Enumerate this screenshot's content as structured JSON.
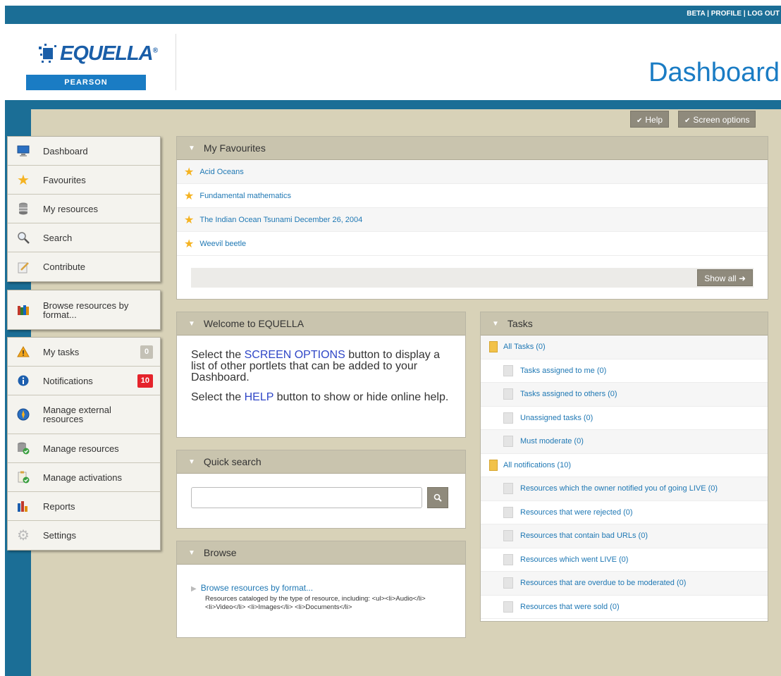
{
  "topbar": {
    "links": "BETA | PROFILE | LOG OUT"
  },
  "brand": {
    "name": "EQUELLA",
    "reg": "®",
    "publisher": "PEARSON"
  },
  "page": {
    "title": "Dashboard"
  },
  "toolbar": {
    "help": "Help",
    "screen_options": "Screen options"
  },
  "sidebar": {
    "group1": [
      {
        "label": "Dashboard",
        "icon": "monitor-icon"
      },
      {
        "label": "Favourites",
        "icon": "star-icon"
      },
      {
        "label": "My resources",
        "icon": "database-icon"
      },
      {
        "label": "Search",
        "icon": "magnifier-icon"
      },
      {
        "label": "Contribute",
        "icon": "edit-icon"
      }
    ],
    "group2": [
      {
        "label": "Browse resources by format...",
        "icon": "books-icon"
      }
    ],
    "group3": [
      {
        "label": "My tasks",
        "icon": "warning-icon",
        "badge": "0"
      },
      {
        "label": "Notifications",
        "icon": "info-icon",
        "badge": "10"
      },
      {
        "label": "Manage external resources",
        "icon": "compass-icon"
      },
      {
        "label": "Manage resources",
        "icon": "database-check-icon"
      },
      {
        "label": "Manage activations",
        "icon": "clipboard-check-icon"
      },
      {
        "label": "Reports",
        "icon": "bar-chart-icon"
      },
      {
        "label": "Settings",
        "icon": "gear-icon"
      }
    ]
  },
  "favourites": {
    "title": "My Favourites",
    "items": [
      "Acid Oceans",
      "Fundamental mathematics",
      "The Indian Ocean Tsunami December 26, 2004",
      "Weevil beetle"
    ],
    "show_all": "Show all"
  },
  "welcome": {
    "title": "Welcome to EQUELLA",
    "p1_pre": "Select the ",
    "p1_hl": "SCREEN OPTIONS",
    "p1_post": " button to display a list of other portlets that can be added to your Dashboard.",
    "p2_pre": "Select the ",
    "p2_hl": "HELP",
    "p2_post": " button to show or hide online help."
  },
  "quick_search": {
    "title": "Quick search",
    "placeholder": ""
  },
  "browse": {
    "title": "Browse",
    "link": "Browse resources by format...",
    "description": "Resources cataloged by the type of resource, including: <ul><li>Audio</li> <li>Video</li> <li>Images</li> <li>Documents</li>"
  },
  "tasks": {
    "title": "Tasks",
    "rows": [
      {
        "label": "All Tasks (0)",
        "group": true
      },
      {
        "label": "Tasks assigned to me (0)",
        "group": false
      },
      {
        "label": "Tasks assigned to others (0)",
        "group": false
      },
      {
        "label": "Unassigned tasks (0)",
        "group": false
      },
      {
        "label": "Must moderate (0)",
        "group": false
      },
      {
        "label": "All notifications (10)",
        "group": true
      },
      {
        "label": "Resources which the owner notified you of going LIVE (0)",
        "group": false
      },
      {
        "label": "Resources that were rejected (0)",
        "group": false
      },
      {
        "label": "Resources that contain bad URLs (0)",
        "group": false
      },
      {
        "label": "Resources which went LIVE (0)",
        "group": false
      },
      {
        "label": "Resources that are overdue to be moderated (0)",
        "group": false
      },
      {
        "label": "Resources that were sold (0)",
        "group": false
      }
    ]
  },
  "colors": {
    "accent": "#1a7cc4",
    "topbar": "#1b6e96",
    "content_bg": "#d8d2b8",
    "portlet_head": "#c9c4ae",
    "badge_red": "#e5232b"
  }
}
